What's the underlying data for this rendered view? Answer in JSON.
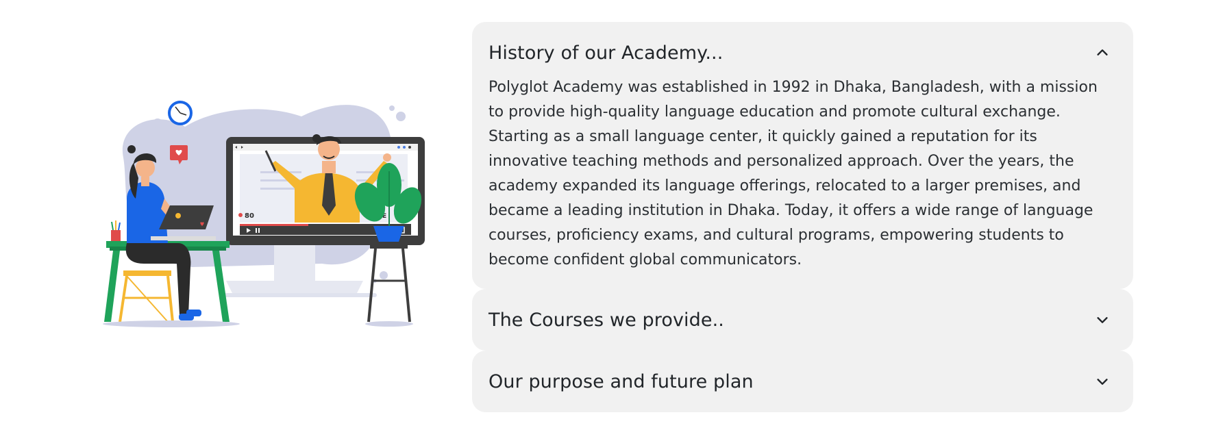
{
  "accordion": {
    "items": [
      {
        "title": "History of our Academy...",
        "expanded": true,
        "body": "Polyglot Academy was established in 1992 in Dhaka, Bangladesh, with a mission to provide high-quality language education and promote cultural exchange. Starting as a small language center, it quickly gained a reputation for its innovative teaching methods and personalized approach. Over the years, the academy expanded its language offerings, relocated to a larger premises, and became a leading institution in Dhaka. Today, it offers a wide range of language courses, proficiency exams, and cultural programs, empowering students to become confident global communicators."
      },
      {
        "title": "The Courses we provide..",
        "expanded": false
      },
      {
        "title": "Our purpose and future plan",
        "expanded": false
      }
    ]
  },
  "illustration": {
    "viewer_count": "80",
    "live_label": "LIVE"
  },
  "colors": {
    "panel_bg": "#f1f1f1",
    "accent_blue": "#1a66e6",
    "accent_yellow": "#f5b731",
    "accent_green": "#1fa35a",
    "monitor_dark": "#3d3d3d",
    "blob": "#cfd2e6"
  }
}
